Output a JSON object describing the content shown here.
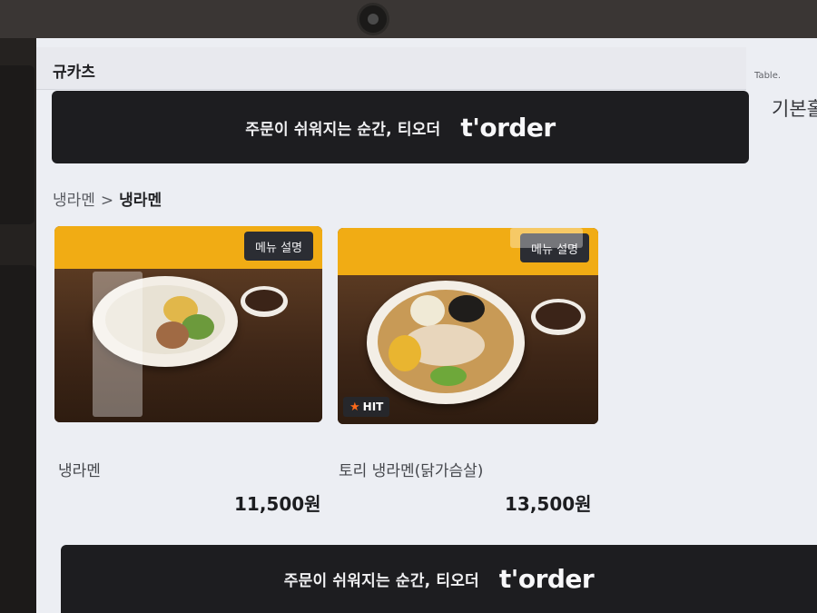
{
  "store": {
    "name": "규카츠"
  },
  "table": {
    "label": "Table."
  },
  "category_tab": {
    "label": "기본홀"
  },
  "banner": {
    "tagline": "주문이 쉬워지는 순간, 티오더",
    "logo": "t'order"
  },
  "breadcrumb": {
    "parent": "냉라멘",
    "separator": ">",
    "current": "냉라멘"
  },
  "menu": {
    "description_label": "메뉴 설명",
    "items": [
      {
        "name": "냉라멘",
        "price": "11,500원",
        "badge": ""
      },
      {
        "name": "토리 냉라멘(닭가슴살)",
        "price": "13,500원",
        "badge": "HIT"
      }
    ]
  },
  "colors": {
    "banner_bg": "#1d1d20",
    "card_header": "#f1ac14",
    "hit_star": "#ff6a1a"
  }
}
